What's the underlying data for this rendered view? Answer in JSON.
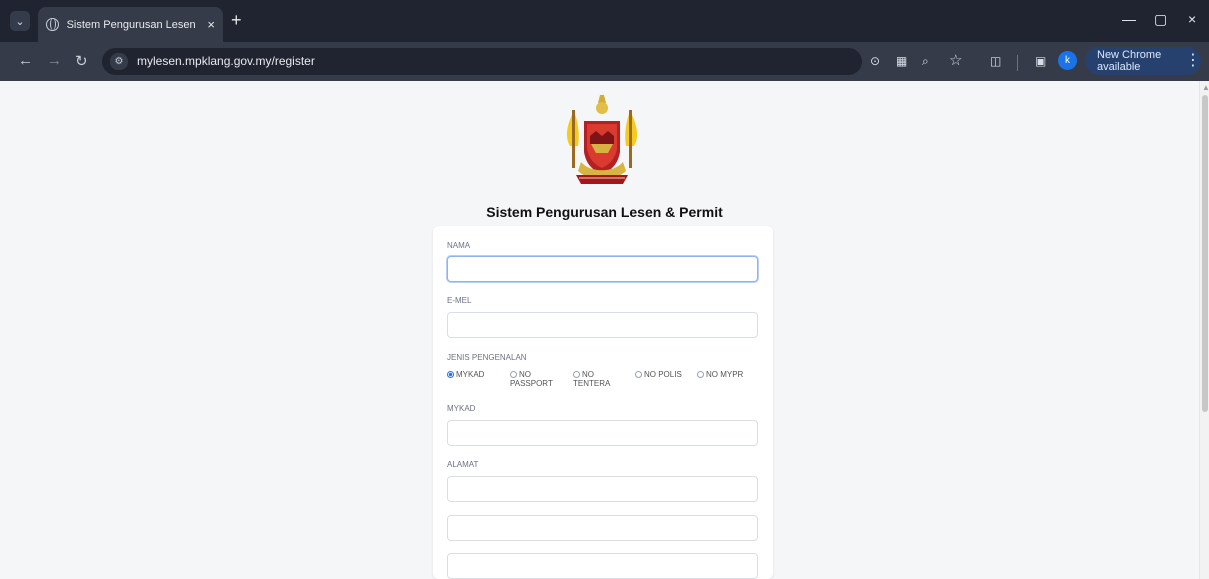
{
  "browser": {
    "tab_title": "Sistem Pengurusan Lesen & Per",
    "url": "mylesen.mpklang.gov.my/register",
    "profile_initial": "k",
    "update_label": "New Chrome available"
  },
  "page": {
    "heading": "Sistem Pengurusan Lesen & Permit",
    "fields": {
      "nama": {
        "label": "NAMA",
        "value": ""
      },
      "email": {
        "label": "E-MEL",
        "value": ""
      },
      "identification": {
        "label": "JENIS PENGENALAN",
        "selected": "MYKAD",
        "options": [
          "MYKAD",
          "NO PASSPORT",
          "NO TENTERA",
          "NO POLIS",
          "NO MYPR"
        ]
      },
      "mykad": {
        "label": "MYKAD",
        "value": ""
      },
      "address": {
        "label": "ALAMAT",
        "line_1": "",
        "line_2": "",
        "line_3": ""
      }
    }
  }
}
